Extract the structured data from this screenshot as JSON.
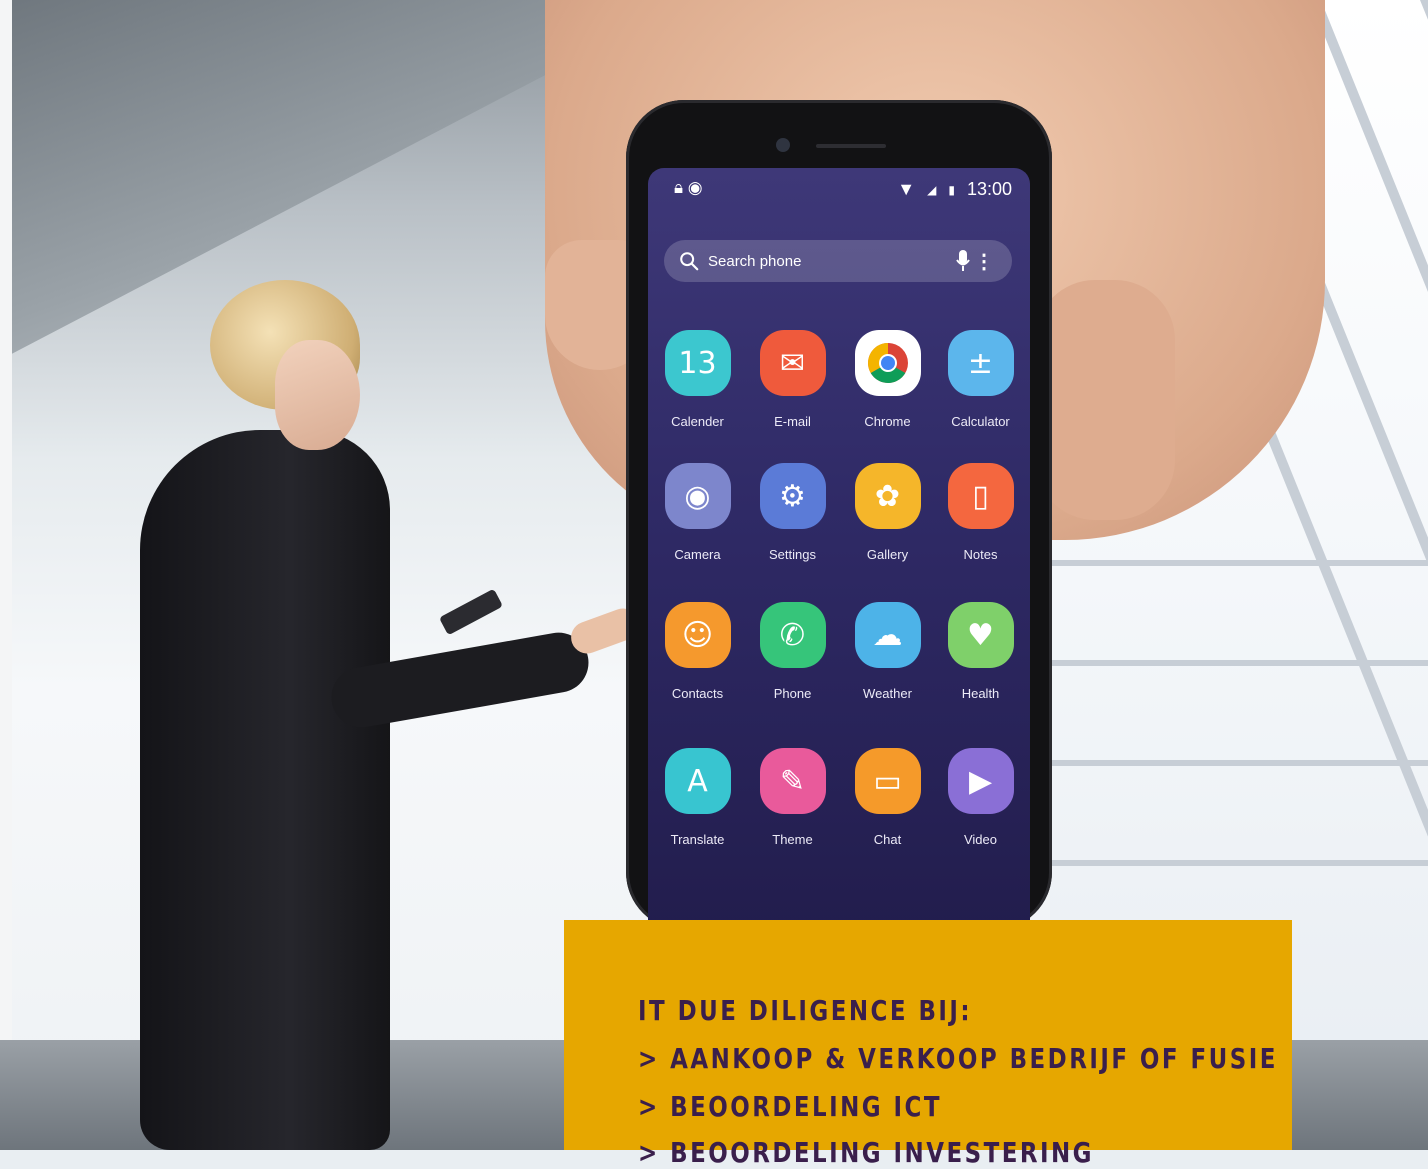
{
  "status_bar": {
    "time": "13:00"
  },
  "search": {
    "placeholder": "Search phone"
  },
  "apps": [
    {
      "label": "Calender",
      "icon": "calendar-icon",
      "color": "#3cc7cf",
      "glyph": "13"
    },
    {
      "label": "E-mail",
      "icon": "email-icon",
      "color": "#ef5a3c",
      "glyph": "✉"
    },
    {
      "label": "Chrome",
      "icon": "chrome-icon",
      "color": "#ffffff",
      "glyph": ""
    },
    {
      "label": "Calculator",
      "icon": "calculator-icon",
      "color": "#5cb6ec",
      "glyph": "±"
    },
    {
      "label": "Camera",
      "icon": "camera-icon",
      "color": "#7d86cc",
      "glyph": "◉"
    },
    {
      "label": "Settings",
      "icon": "settings-icon",
      "color": "#5b7bd7",
      "glyph": "⚙"
    },
    {
      "label": "Gallery",
      "icon": "gallery-icon",
      "color": "#f5b62a",
      "glyph": "✿"
    },
    {
      "label": "Notes",
      "icon": "notes-icon",
      "color": "#f4673f",
      "glyph": "▯"
    },
    {
      "label": "Contacts",
      "icon": "contacts-icon",
      "color": "#f5992d",
      "glyph": "☺"
    },
    {
      "label": "Phone",
      "icon": "phone-icon",
      "color": "#36c57a",
      "glyph": "✆"
    },
    {
      "label": "Weather",
      "icon": "weather-icon",
      "color": "#4db3e8",
      "glyph": "☁"
    },
    {
      "label": "Health",
      "icon": "health-icon",
      "color": "#7fd06a",
      "glyph": "♥"
    },
    {
      "label": "Translate",
      "icon": "translate-icon",
      "color": "#38c5d0",
      "glyph": "A"
    },
    {
      "label": "Theme",
      "icon": "theme-icon",
      "color": "#e95a9b",
      "glyph": "✎"
    },
    {
      "label": "Chat",
      "icon": "chat-icon",
      "color": "#f59a2a",
      "glyph": "▭"
    },
    {
      "label": "Video",
      "icon": "video-icon",
      "color": "#8a6fd6",
      "glyph": "▶"
    }
  ],
  "panel": {
    "heading": "IT DUE DILIGENCE BIJ:",
    "items": [
      "> AANKOOP & VERKOOP BEDRIJF OF FUSIE",
      "> BEOORDELING ICT",
      "> BEOORDELING INVESTERING"
    ],
    "background": "#e6a700",
    "text_color": "#3a1f4c"
  }
}
